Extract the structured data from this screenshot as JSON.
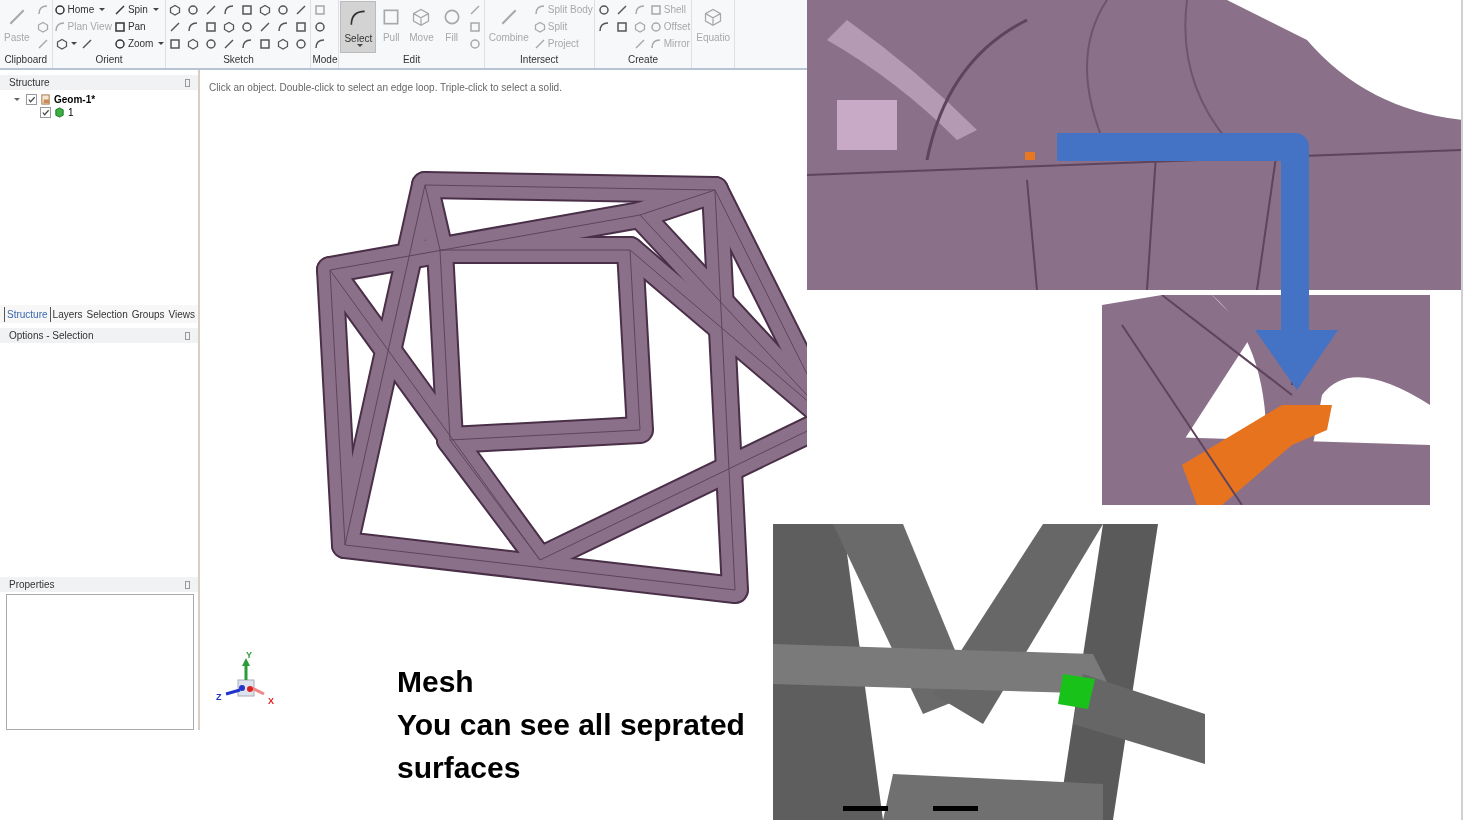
{
  "ribbon": {
    "groups": [
      {
        "label": "Clipboard",
        "columns": [
          [
            [
              {
                "kind": "large",
                "label": "Paste",
                "disabled": true,
                "dropdown": false,
                "selected": false
              }
            ]
          ],
          [
            [
              {
                "kind": "icon",
                "disabled": true,
                "dropdown": false
              }
            ],
            [
              {
                "kind": "icon",
                "disabled": true,
                "dropdown": false
              }
            ],
            [
              {
                "kind": "icon",
                "disabled": true,
                "dropdown": false
              }
            ]
          ]
        ]
      },
      {
        "label": "Orient",
        "columns": [
          [
            [
              {
                "kind": "small",
                "label": "Home",
                "disabled": false,
                "dropdown": true
              }
            ],
            [
              {
                "kind": "small",
                "label": "Plan View",
                "disabled": true,
                "dropdown": false
              }
            ],
            [
              {
                "kind": "icon",
                "disabled": false,
                "dropdown": true
              },
              {
                "kind": "icon",
                "disabled": false,
                "dropdown": false
              }
            ]
          ],
          [
            [
              {
                "kind": "small",
                "label": "Spin",
                "disabled": false,
                "dropdown": true
              }
            ],
            [
              {
                "kind": "small",
                "label": "Pan",
                "disabled": false,
                "dropdown": false
              }
            ],
            [
              {
                "kind": "small",
                "label": "Zoom",
                "disabled": false,
                "dropdown": true
              }
            ]
          ]
        ]
      },
      {
        "label": "Sketch",
        "columns": [
          [
            [
              {
                "kind": "icon",
                "disabled": false,
                "dropdown": false
              }
            ],
            [
              {
                "kind": "icon",
                "disabled": false,
                "dropdown": false
              }
            ],
            [
              {
                "kind": "icon",
                "disabled": false,
                "dropdown": false
              }
            ]
          ],
          [
            [
              {
                "kind": "icon",
                "disabled": false,
                "dropdown": false
              }
            ],
            [
              {
                "kind": "icon",
                "disabled": false,
                "dropdown": false
              }
            ],
            [
              {
                "kind": "icon",
                "disabled": false,
                "dropdown": false
              }
            ]
          ],
          [
            [
              {
                "kind": "icon",
                "disabled": false,
                "dropdown": false
              }
            ],
            [
              {
                "kind": "icon",
                "disabled": false,
                "dropdown": false
              }
            ],
            [
              {
                "kind": "icon",
                "disabled": false,
                "dropdown": false
              }
            ]
          ],
          [
            [
              {
                "kind": "icon",
                "disabled": false,
                "dropdown": false
              }
            ],
            [
              {
                "kind": "icon",
                "disabled": false,
                "dropdown": false
              }
            ],
            [
              {
                "kind": "icon",
                "disabled": false,
                "dropdown": false
              }
            ]
          ],
          [
            [
              {
                "kind": "icon",
                "disabled": false,
                "dropdown": false
              }
            ],
            [
              {
                "kind": "icon",
                "disabled": false,
                "dropdown": false
              }
            ],
            [
              {
                "kind": "icon",
                "disabled": false,
                "dropdown": false
              }
            ]
          ],
          [
            [
              {
                "kind": "icon",
                "disabled": false,
                "dropdown": false
              }
            ],
            [
              {
                "kind": "icon",
                "disabled": false,
                "dropdown": false
              }
            ],
            [
              {
                "kind": "icon",
                "disabled": false,
                "dropdown": false
              }
            ]
          ],
          [
            [
              {
                "kind": "icon",
                "disabled": false,
                "dropdown": false
              }
            ],
            [
              {
                "kind": "icon",
                "disabled": false,
                "dropdown": false
              }
            ],
            [
              {
                "kind": "icon",
                "disabled": false,
                "dropdown": false
              }
            ]
          ],
          [
            [
              {
                "kind": "icon",
                "disabled": false,
                "dropdown": false
              }
            ],
            [
              {
                "kind": "icon",
                "disabled": false,
                "dropdown": false
              }
            ],
            [
              {
                "kind": "icon",
                "disabled": false,
                "dropdown": false
              }
            ]
          ]
        ]
      },
      {
        "label": "Mode",
        "columns": [
          [
            [
              {
                "kind": "icon",
                "disabled": true,
                "dropdown": false
              }
            ],
            [
              {
                "kind": "icon",
                "disabled": false,
                "dropdown": false
              }
            ],
            [
              {
                "kind": "icon",
                "disabled": false,
                "dropdown": false
              }
            ]
          ]
        ]
      },
      {
        "label": "Edit",
        "columns": [
          [
            [
              {
                "kind": "large",
                "label": "Select",
                "disabled": false,
                "dropdown": true,
                "selected": true
              }
            ]
          ],
          [
            [
              {
                "kind": "large",
                "label": "Pull",
                "disabled": true,
                "dropdown": false,
                "selected": false
              }
            ]
          ],
          [
            [
              {
                "kind": "large",
                "label": "Move",
                "disabled": true,
                "dropdown": false,
                "selected": false
              }
            ]
          ],
          [
            [
              {
                "kind": "large",
                "label": "Fill",
                "disabled": true,
                "dropdown": false,
                "selected": false
              }
            ]
          ],
          [
            [
              {
                "kind": "icon",
                "disabled": true,
                "dropdown": false
              }
            ],
            [
              {
                "kind": "icon",
                "disabled": true,
                "dropdown": false
              }
            ],
            [
              {
                "kind": "icon",
                "disabled": true,
                "dropdown": false
              }
            ]
          ]
        ]
      },
      {
        "label": "Intersect",
        "columns": [
          [
            [
              {
                "kind": "large",
                "label": "Combine",
                "disabled": true,
                "dropdown": false,
                "selected": false
              }
            ]
          ],
          [
            [
              {
                "kind": "small",
                "label": "Split Body",
                "disabled": true,
                "dropdown": false
              }
            ],
            [
              {
                "kind": "small",
                "label": "Split",
                "disabled": true,
                "dropdown": false
              }
            ],
            [
              {
                "kind": "small",
                "label": "Project",
                "disabled": true,
                "dropdown": false
              }
            ]
          ]
        ]
      },
      {
        "label": "Create",
        "columns": [
          [
            [
              {
                "kind": "icon",
                "disabled": false,
                "dropdown": false
              }
            ],
            [
              {
                "kind": "icon",
                "disabled": false,
                "dropdown": false
              }
            ]
          ],
          [
            [
              {
                "kind": "icon",
                "disabled": false,
                "dropdown": false
              }
            ],
            [
              {
                "kind": "icon",
                "disabled": false,
                "dropdown": false
              }
            ]
          ],
          [
            [
              {
                "kind": "icon",
                "disabled": true,
                "dropdown": false
              }
            ],
            [
              {
                "kind": "icon",
                "disabled": true,
                "dropdown": false
              }
            ],
            [
              {
                "kind": "icon",
                "disabled": true,
                "dropdown": false
              }
            ]
          ],
          [
            [
              {
                "kind": "small",
                "label": "Shell",
                "disabled": true,
                "dropdown": false
              }
            ],
            [
              {
                "kind": "small",
                "label": "Offset",
                "disabled": true,
                "dropdown": false
              }
            ],
            [
              {
                "kind": "small",
                "label": "Mirror",
                "disabled": true,
                "dropdown": false
              }
            ]
          ]
        ]
      },
      {
        "columns": [
          [
            [
              {
                "kind": "large",
                "label": "Equatio",
                "disabled": true,
                "dropdown": false,
                "selected": false
              }
            ]
          ]
        ]
      }
    ]
  },
  "structure_panel": {
    "title": "Structure",
    "tree": [
      {
        "label": "Geom-1*",
        "checked": true,
        "expanded": true,
        "children": [
          {
            "label": "1",
            "checked": true
          }
        ]
      }
    ]
  },
  "panel_tabs": [
    {
      "label": "Structure",
      "selected": true
    },
    {
      "label": "Layers",
      "selected": false
    },
    {
      "label": "Selection",
      "selected": false
    },
    {
      "label": "Groups",
      "selected": false
    },
    {
      "label": "Views",
      "selected": false
    }
  ],
  "options_panel": {
    "title": "Options - Selection"
  },
  "properties_panel": {
    "title": "Properties"
  },
  "viewport": {
    "hint": "Click an object. Double-click to select an edge loop. Triple-click to select a solid.",
    "triad": {
      "labels": [
        "Y",
        "Z",
        "X"
      ]
    }
  },
  "slide_text": {
    "heading": "Mesh",
    "body": "You can see all seprated surfaces"
  }
}
